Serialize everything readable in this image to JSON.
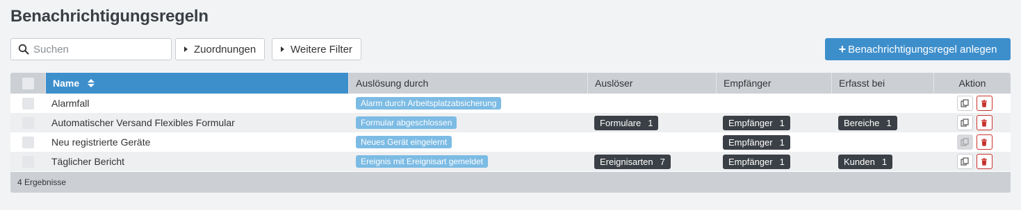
{
  "page": {
    "title": "Benachrichtigungsregeln"
  },
  "toolbar": {
    "search_placeholder": "Suchen",
    "filters": [
      "Zuordnungen",
      "Weitere Filter"
    ],
    "create_label": "Benachrichtigungsregel anlegen"
  },
  "table": {
    "columns": [
      "Name",
      "Auslösung durch",
      "Auslöser",
      "Empfänger",
      "Erfasst bei",
      "Aktion"
    ],
    "rows": [
      {
        "name": "Alarmfall",
        "trigger": "Alarm durch Arbeitsplatzabsicherung",
        "ausloeser": null,
        "empfaenger": null,
        "erfasst": null,
        "copy_disabled": false
      },
      {
        "name": "Automatischer Versand Flexibles Formular",
        "trigger": "Formular abgeschlossen",
        "ausloeser": {
          "label": "Formulare",
          "count": "1"
        },
        "empfaenger": {
          "label": "Empfänger",
          "count": "1"
        },
        "erfasst": {
          "label": "Bereiche",
          "count": "1"
        },
        "copy_disabled": false
      },
      {
        "name": "Neu registrierte Geräte",
        "trigger": "Neues Gerät eingelernt",
        "ausloeser": null,
        "empfaenger": {
          "label": "Empfänger",
          "count": "1"
        },
        "erfasst": null,
        "copy_disabled": true
      },
      {
        "name": "Täglicher Bericht",
        "trigger": "Ereignis mit Ereignisart gemeldet",
        "ausloeser": {
          "label": "Ereignisarten",
          "count": "7"
        },
        "empfaenger": {
          "label": "Empfänger",
          "count": "1"
        },
        "erfasst": {
          "label": "Kunden",
          "count": "1"
        },
        "copy_disabled": false
      }
    ],
    "footer": "4 Ergebnisse"
  },
  "colors": {
    "primary": "#3d8fcc",
    "trigger_pill": "#7cbbe4",
    "dark_tag": "#3b4046",
    "delete": "#c8312c"
  },
  "icons": {
    "search": "search-icon",
    "filter_toggle": "caret-right-icon",
    "create": "plus-icon",
    "sort": "sort-icon",
    "copy": "copy-icon",
    "delete": "trash-icon"
  }
}
